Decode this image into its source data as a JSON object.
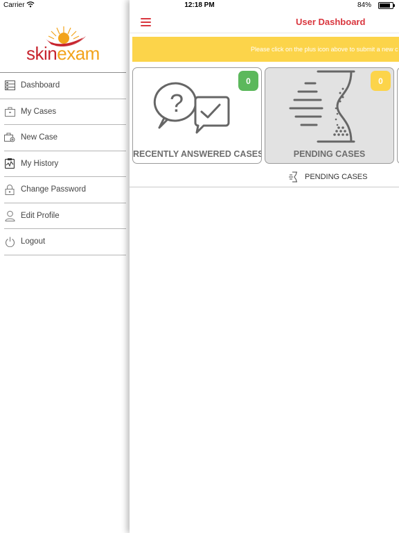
{
  "status_bar": {
    "carrier": "Carrier",
    "time": "12:18 PM",
    "battery": "84%",
    "battery_level": 0.84
  },
  "sidebar": {
    "logo": {
      "part1": "skin",
      "part2": "exam"
    },
    "items": [
      {
        "label": "Dashboard",
        "icon": "dashboard-icon"
      },
      {
        "label": "My Cases",
        "icon": "briefcase-icon"
      },
      {
        "label": "New Case",
        "icon": "new-case-icon"
      },
      {
        "label": "My History",
        "icon": "history-icon"
      },
      {
        "label": "Change Password",
        "icon": "lock-icon"
      },
      {
        "label": "Edit Profile",
        "icon": "user-icon"
      },
      {
        "label": "Logout",
        "icon": "power-icon"
      }
    ]
  },
  "header": {
    "title": "User Dashboard",
    "menu_icon": "hamburger-icon"
  },
  "banner": {
    "text": "Please click on the plus icon above to submit a new c"
  },
  "cards": [
    {
      "title": "RECENTLY ANSWERED CASES",
      "count": "0",
      "badge_color": "#5cb85c",
      "icon": "question-answer-icon"
    },
    {
      "title": "PENDING CASES",
      "count": "0",
      "badge_color": "#fcd44a",
      "icon": "hourglass-icon"
    }
  ],
  "section": {
    "label": "PENDING CASES",
    "icon": "hourglass-icon"
  },
  "colors": {
    "accent": "#d9363e",
    "banner": "#fcd44a",
    "logo_red": "#c7242e",
    "logo_orange": "#f2a31b"
  }
}
